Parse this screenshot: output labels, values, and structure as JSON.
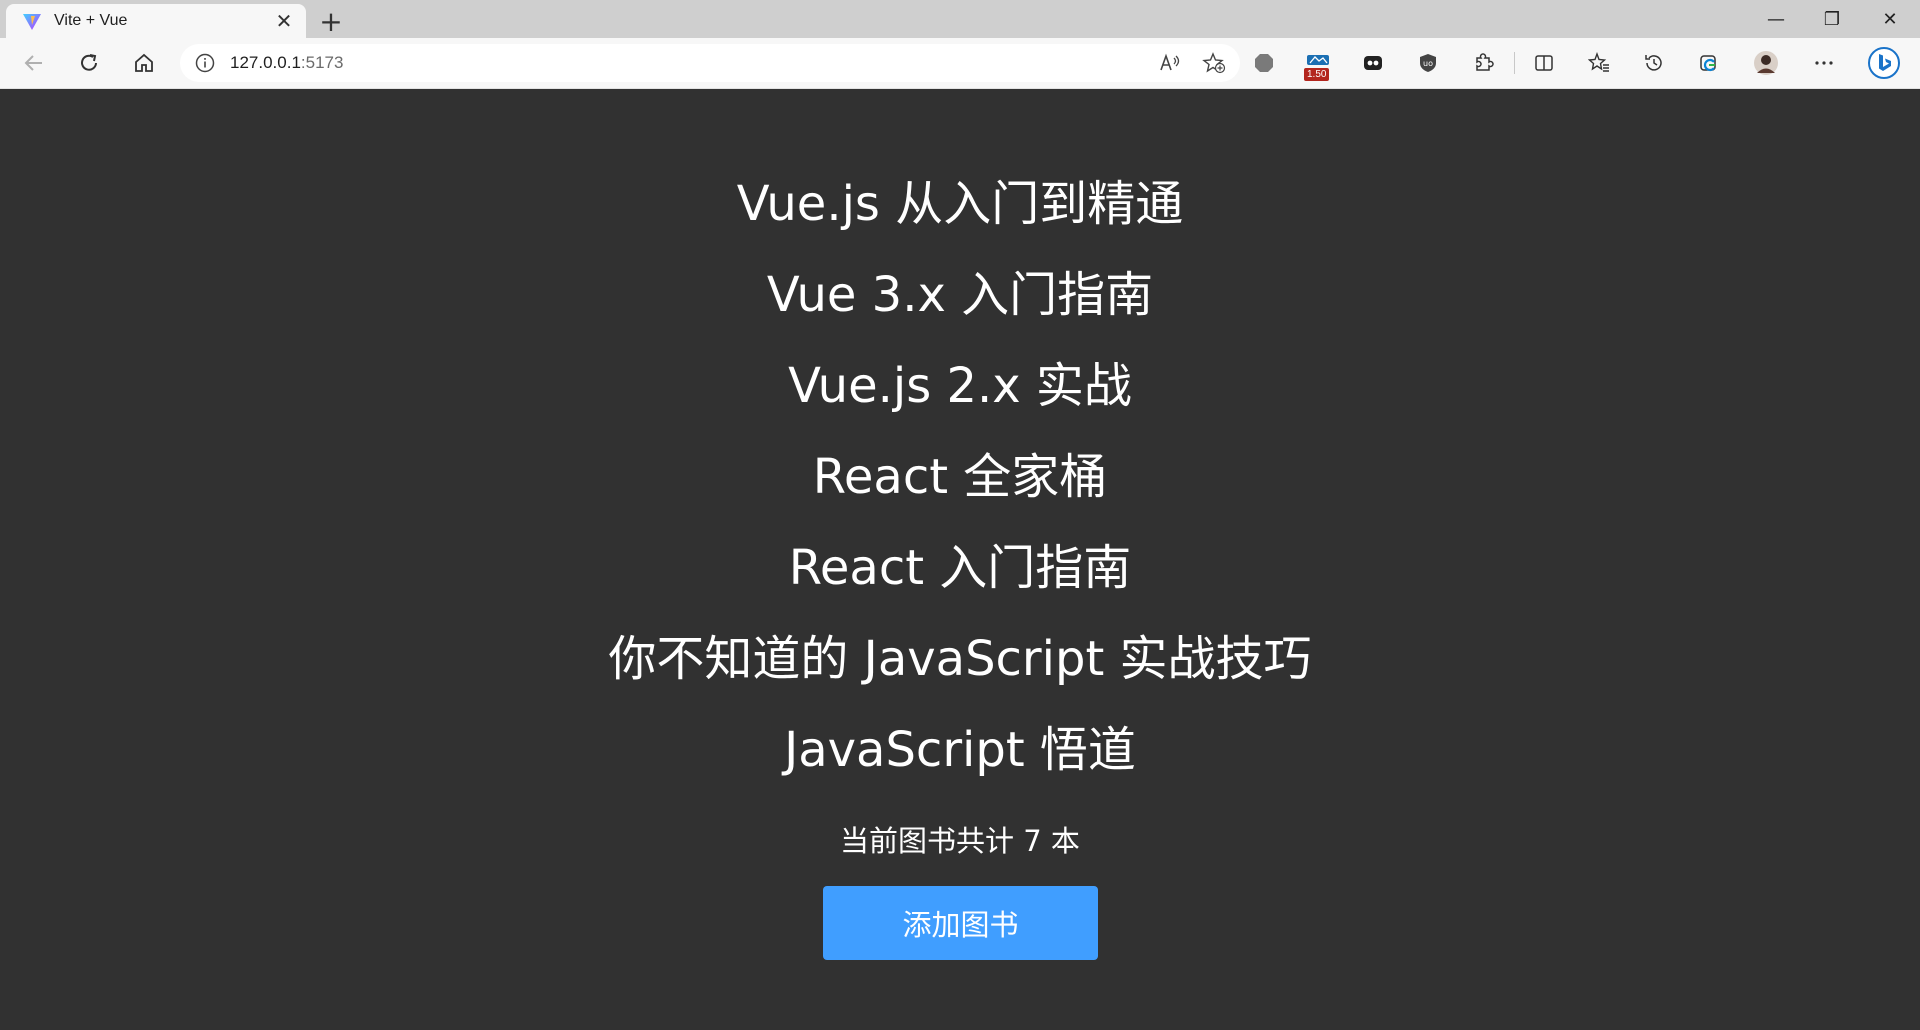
{
  "browser": {
    "tab": {
      "title": "Vite + Vue",
      "close_glyph": "✕",
      "favicon": "vite-logo-icon"
    },
    "new_tab_glyph": "+",
    "window_controls": {
      "minimize": "—",
      "restore": "❐",
      "close": "✕"
    },
    "address": {
      "host": "127.0.0.1",
      "port": ":5173"
    },
    "extension_badge": "1.50",
    "accent_color": "#409eff",
    "icons": [
      "back-icon",
      "refresh-icon",
      "home-icon",
      "site-info-icon",
      "read-aloud-icon",
      "add-favorite-icon",
      "extension-icon",
      "split-screen-icon",
      "favorites-icon",
      "history-icon",
      "collections-icon",
      "profile-avatar",
      "more-icon",
      "bing-icon"
    ]
  },
  "page": {
    "background": "#313131",
    "books": [
      {
        "title": "Vue.js 从入门到精通"
      },
      {
        "title": "Vue 3.x 入门指南"
      },
      {
        "title": "Vue.js 2.x 实战"
      },
      {
        "title": "React 全家桶"
      },
      {
        "title": "React 入门指南"
      },
      {
        "title": "你不知道的 JavaScript 实战技巧"
      },
      {
        "title": "JavaScript 悟道"
      }
    ],
    "count_text": "当前图书共计 7 本",
    "add_button_label": "添加图书"
  }
}
